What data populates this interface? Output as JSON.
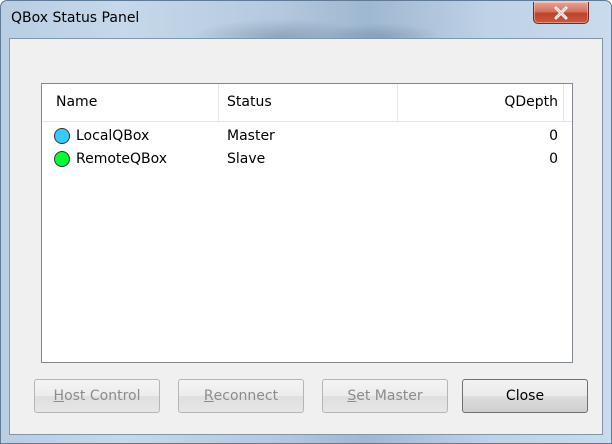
{
  "window": {
    "title": "QBox Status Panel",
    "close_glyph": "x"
  },
  "list": {
    "columns": [
      "Name",
      "Status",
      "QDepth"
    ],
    "rows": [
      {
        "name": "LocalQBox",
        "status": "Master",
        "qdepth": "0",
        "dot_color": "#33ccff",
        "icon": "status-dot-icon"
      },
      {
        "name": "RemoteQBox",
        "status": "Slave",
        "qdepth": "0",
        "dot_color": "#00ff33",
        "icon": "status-dot-icon"
      }
    ]
  },
  "buttons": {
    "host_control": {
      "access": "H",
      "rest": "ost Control"
    },
    "reconnect": {
      "access": "R",
      "rest": "econnect"
    },
    "set_master": {
      "access": "S",
      "rest": "et Master"
    },
    "close": "Close"
  }
}
